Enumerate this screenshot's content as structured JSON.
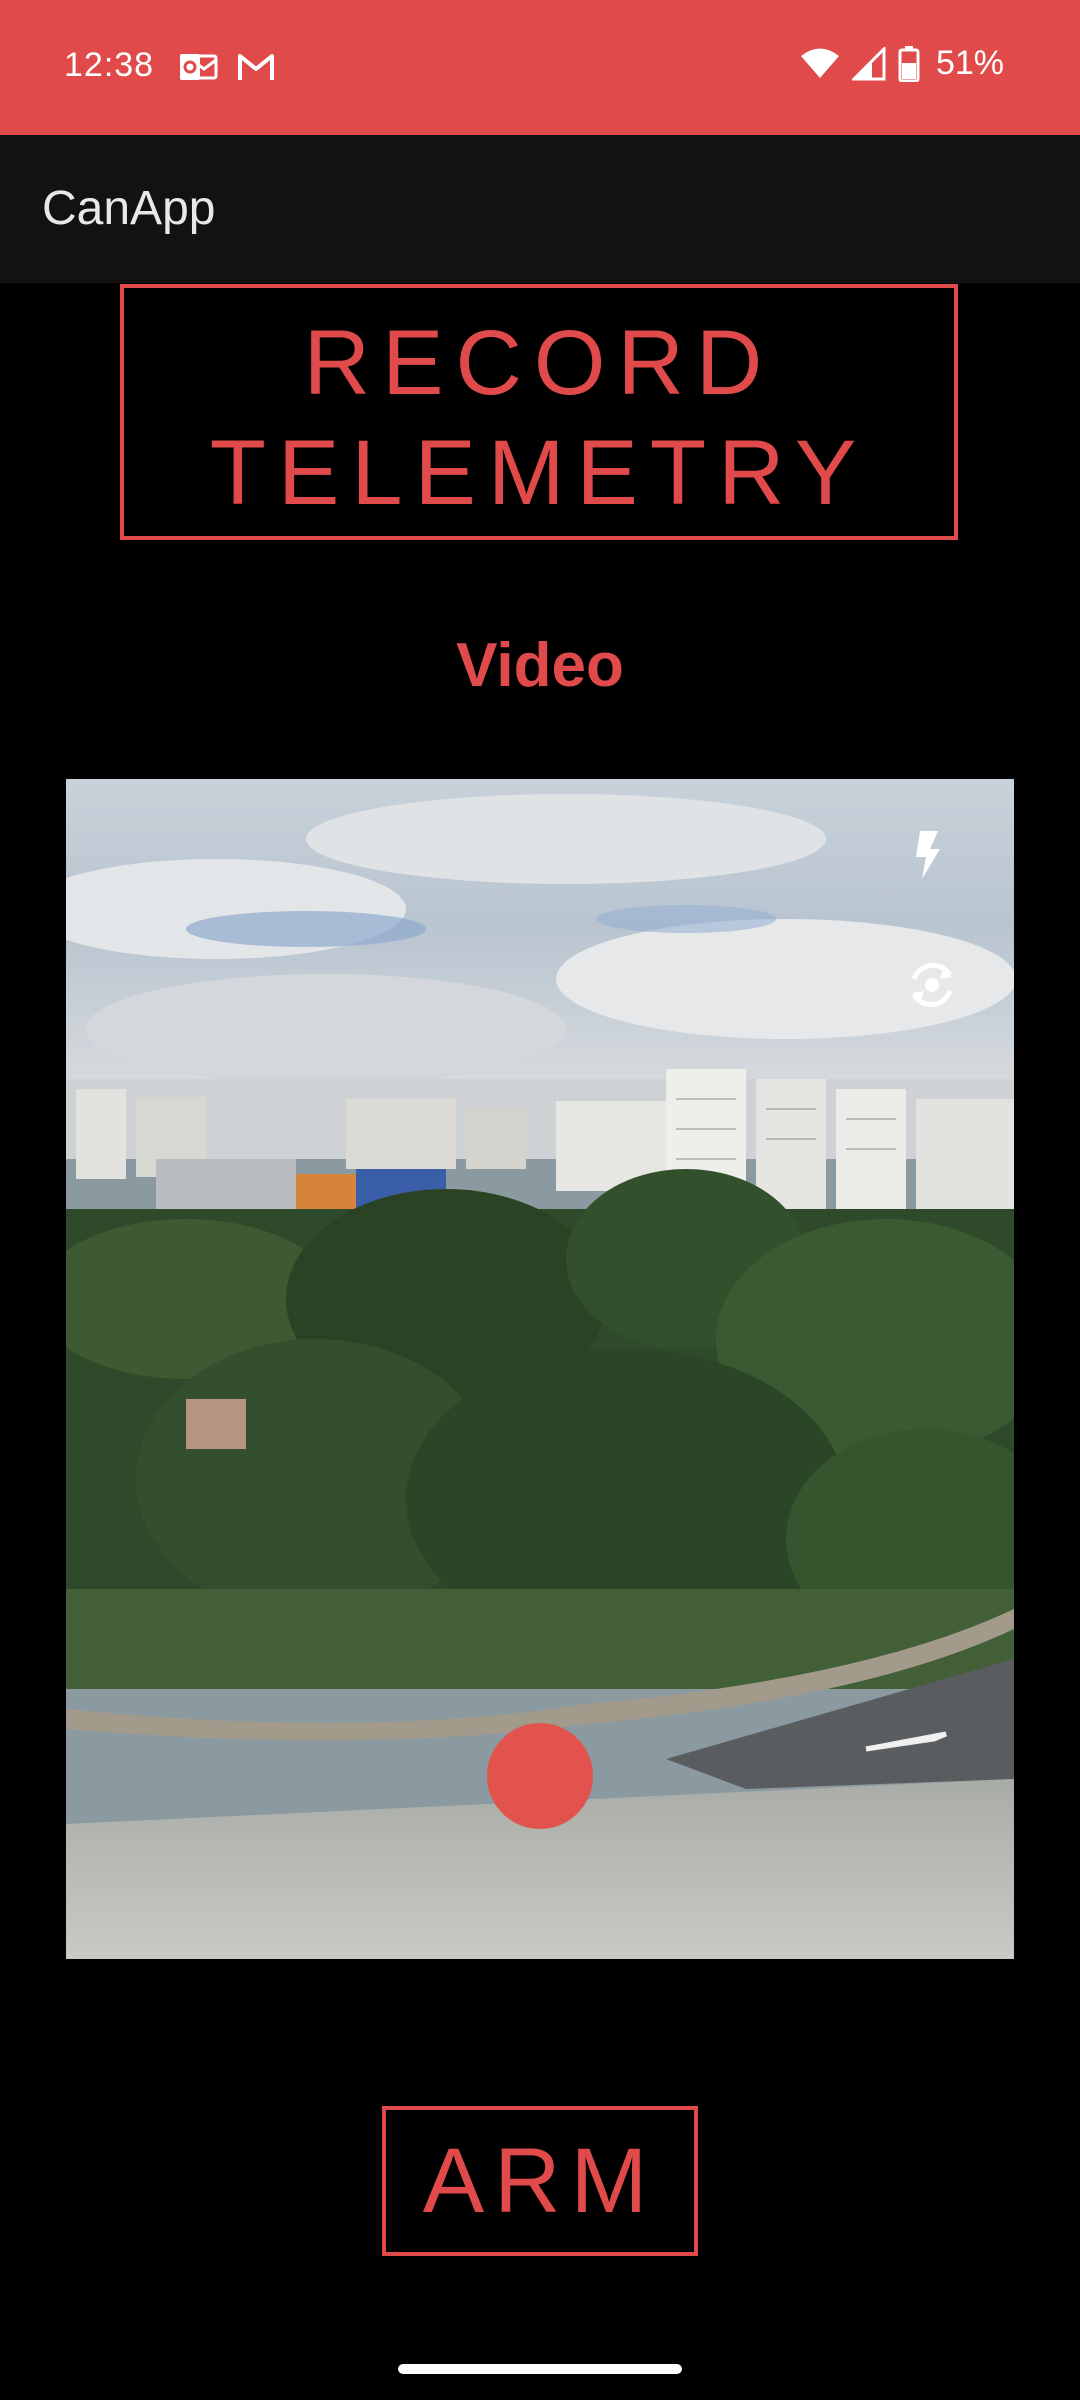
{
  "status_bar": {
    "time": "12:38",
    "battery": "51%",
    "icons": [
      "outlook-notification-icon",
      "gmail-notification-icon",
      "wifi-icon",
      "cell-signal-icon",
      "battery-icon"
    ]
  },
  "app_bar": {
    "title": "CanApp"
  },
  "record_button": {
    "line1": "RECORD",
    "line2": "TELEMETRY"
  },
  "video_label": "Video",
  "camera": {
    "icons": [
      "flash-icon",
      "flip-camera-icon"
    ]
  },
  "arm_button": {
    "label": "ARM"
  },
  "colors": {
    "accent": "#e04a4a",
    "app_bar": "#121212",
    "background": "#000000"
  }
}
